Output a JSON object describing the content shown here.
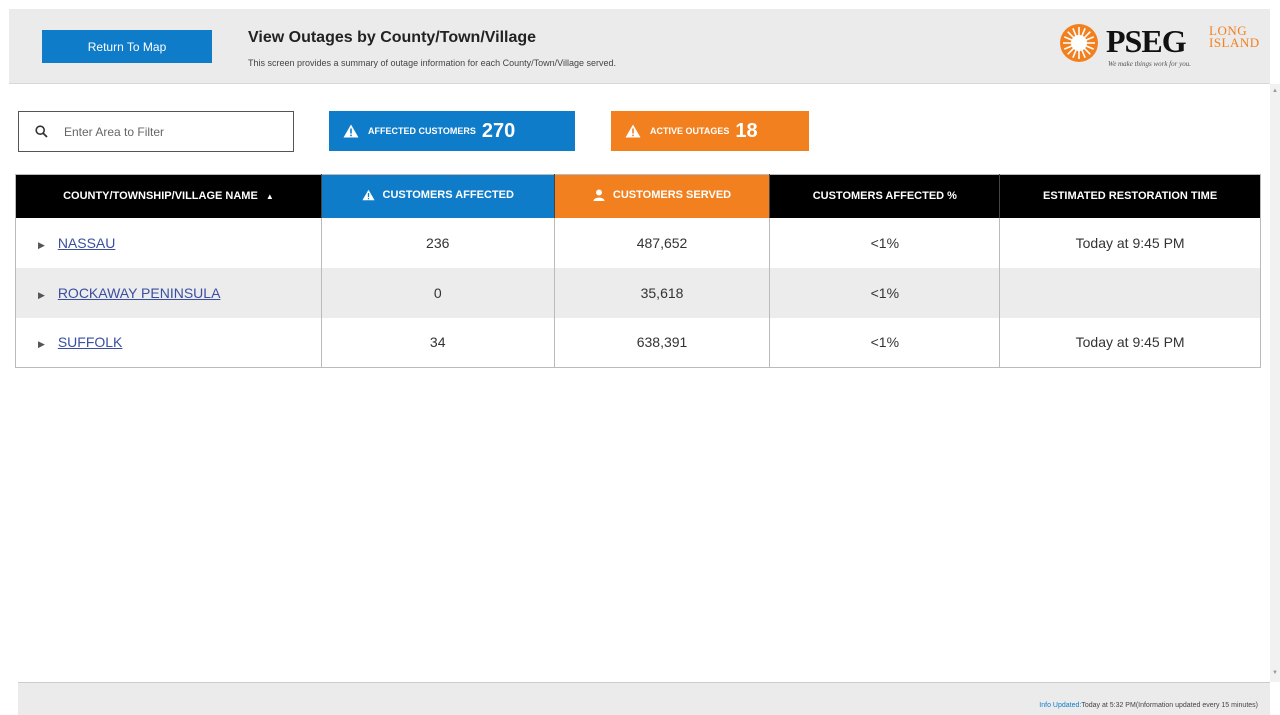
{
  "header": {
    "return_label": "Return To Map",
    "title": "View Outages by County/Town/Village",
    "subtitle": "This screen provides a summary of outage information for each County/Town/Village served.",
    "logo": {
      "brand": "PSEG",
      "long": "LONG",
      "island": "ISLAND",
      "tagline": "We make things work for you."
    }
  },
  "filter": {
    "placeholder": "Enter Area to Filter",
    "icon": "search-icon"
  },
  "badges": {
    "affected_label": "Affected Customers",
    "affected_value": "270",
    "outages_label": "Active Outages",
    "outages_value": "18"
  },
  "table": {
    "headers": {
      "name": "COUNTY/TOWNSHIP/VILLAGE NAME",
      "affected": "CUSTOMERS AFFECTED",
      "served": "CUSTOMERS SERVED",
      "percent": "CUSTOMERS AFFECTED %",
      "restoration": "ESTIMATED RESTORATION TIME"
    },
    "rows": [
      {
        "name": "NASSAU",
        "affected": "236",
        "served": "487,652",
        "percent": "<1%",
        "restoration": "Today at 9:45 PM"
      },
      {
        "name": "ROCKAWAY PENINSULA",
        "affected": "0",
        "served": "35,618",
        "percent": "<1%",
        "restoration": ""
      },
      {
        "name": "SUFFOLK",
        "affected": "34",
        "served": "638,391",
        "percent": "<1%",
        "restoration": "Today at 9:45 PM"
      }
    ]
  },
  "footer": {
    "info_label": "Info Updated:",
    "info_time": "Today at 5:32 PM",
    "info_note": "(Information updated every 15 minutes)"
  },
  "colors": {
    "blue": "#0f7cc9",
    "orange": "#f2801f",
    "header_bg": "#ebebeb"
  }
}
